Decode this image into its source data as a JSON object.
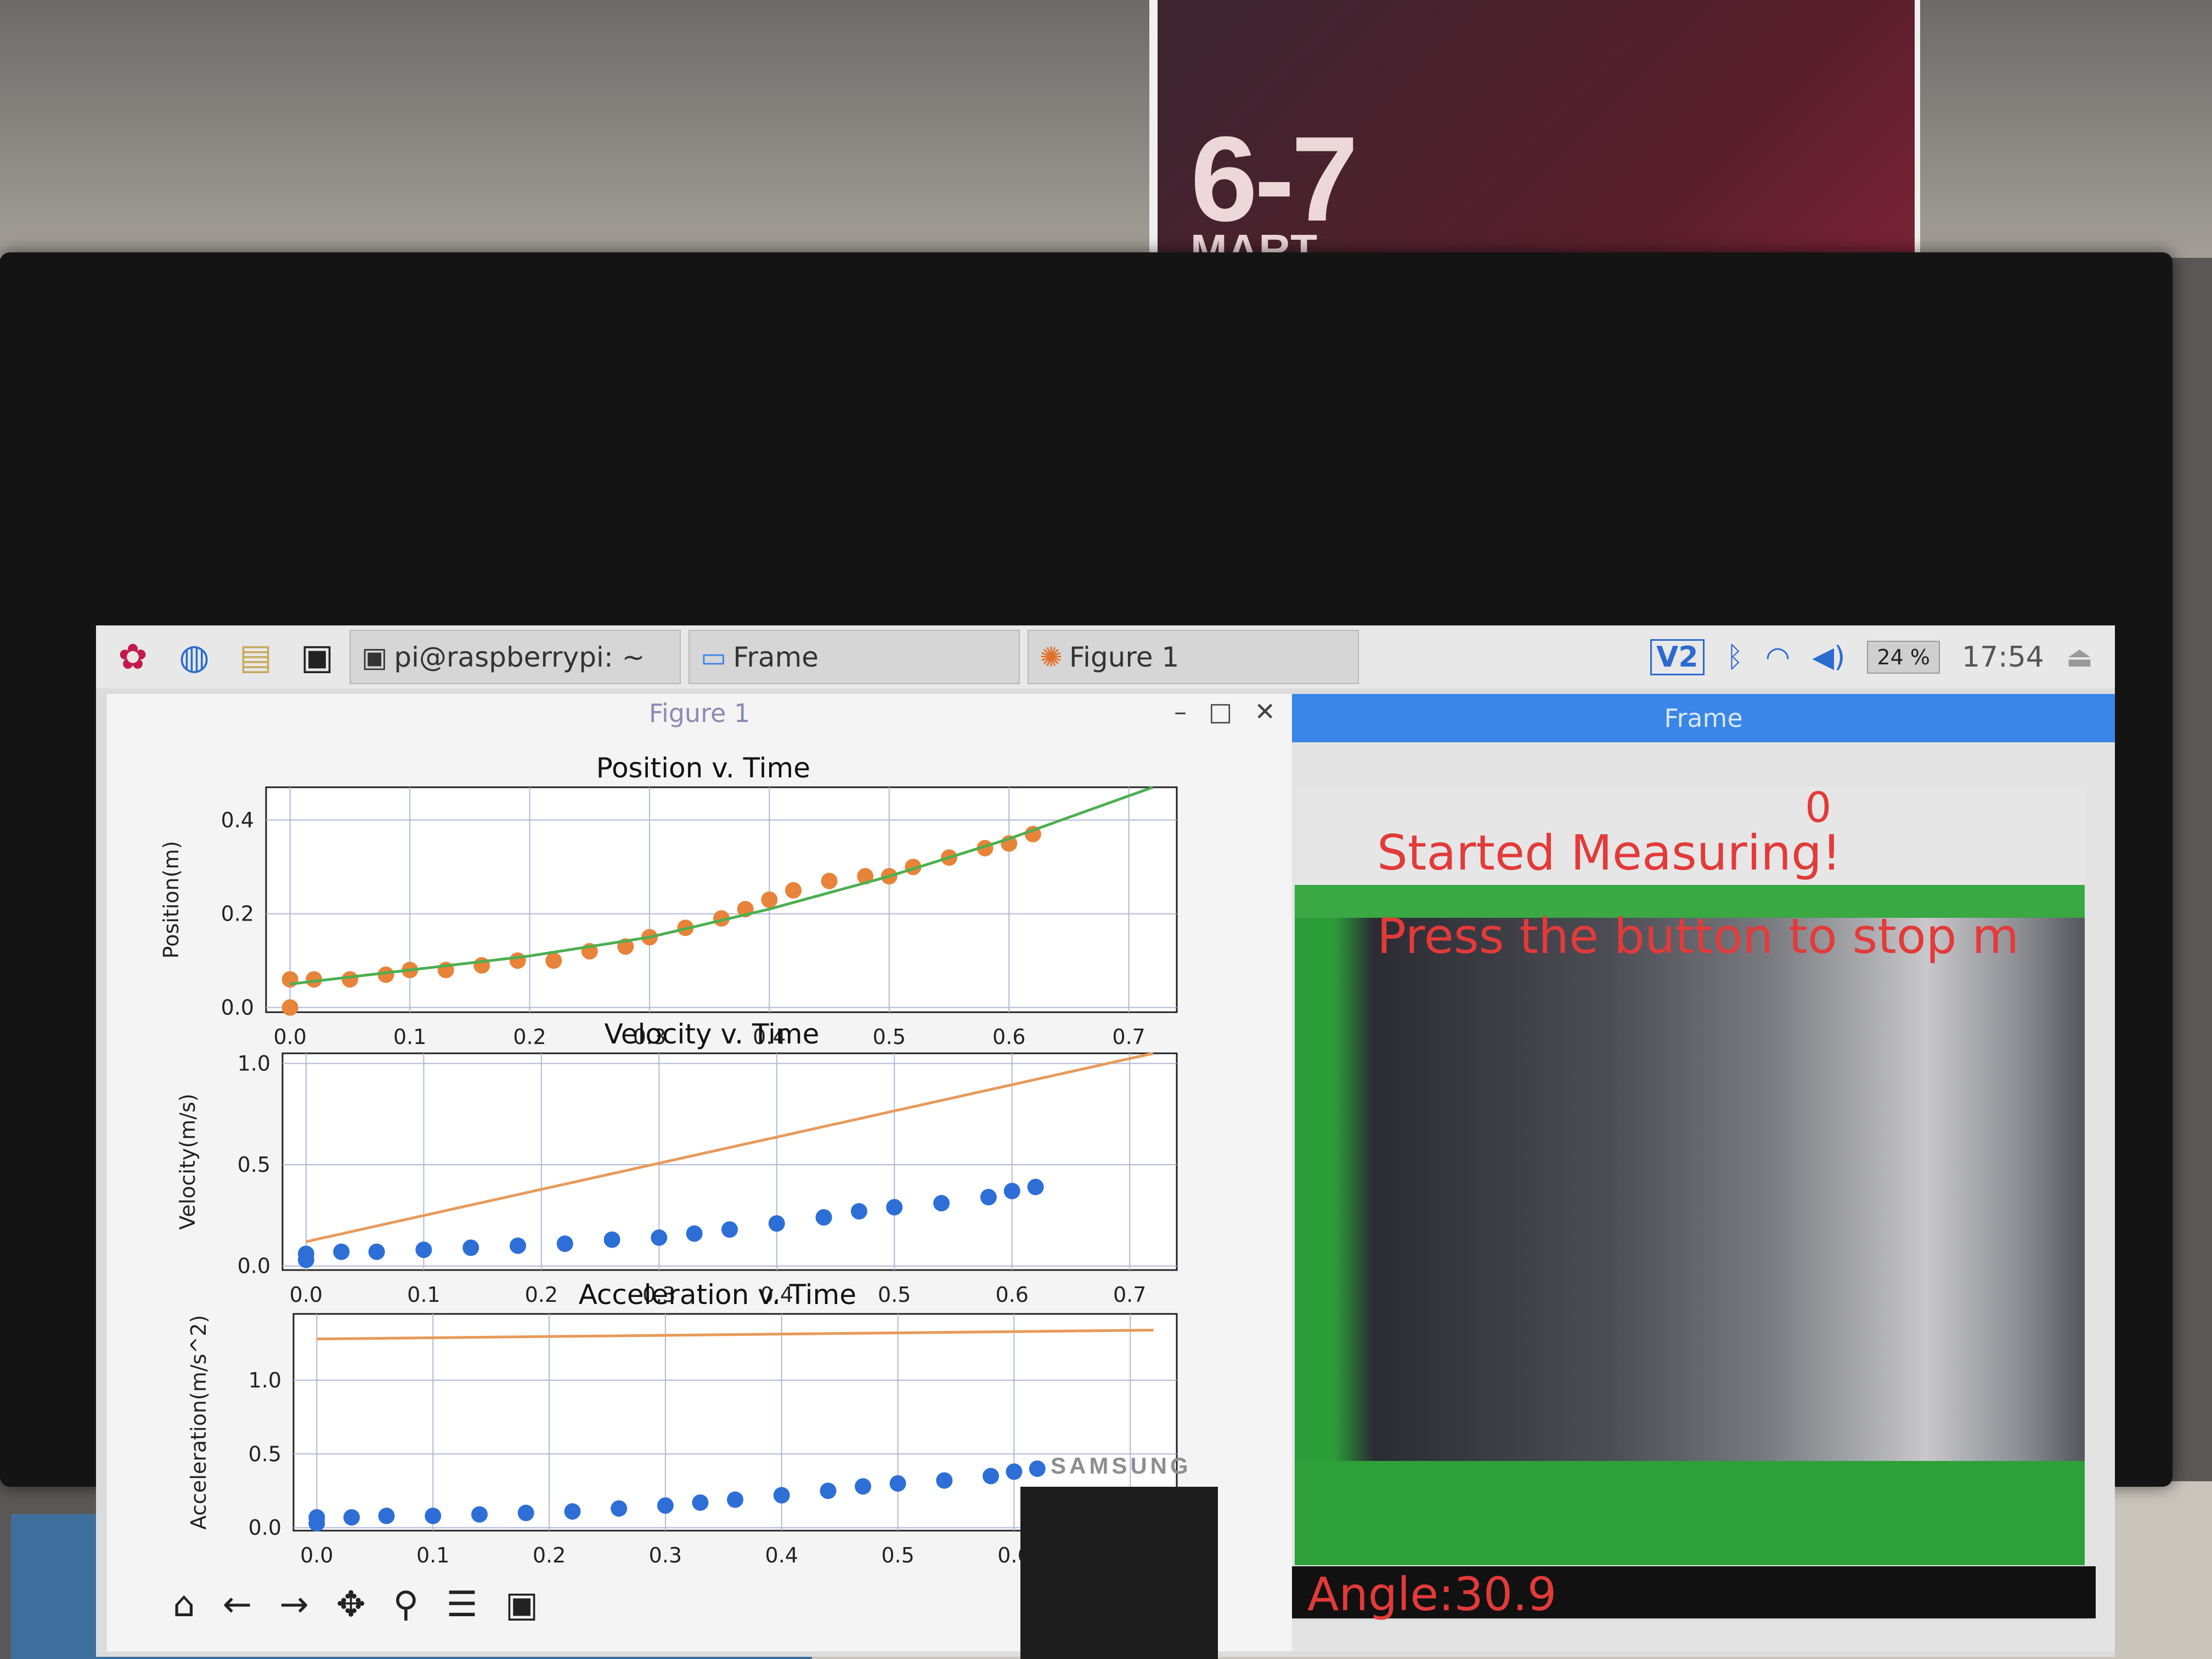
{
  "poster": {
    "date_big": "6-7",
    "date_sub": "MART"
  },
  "monitor": {
    "brand": "SAMSUNG"
  },
  "taskbar": {
    "tasks": [
      {
        "label": "pi@raspberrypi: ~"
      },
      {
        "label": "Frame"
      },
      {
        "label": "Figure 1"
      }
    ],
    "cpu_label": "24 %",
    "clock": "17:54",
    "icons": [
      "raspberry-menu-icon",
      "globe-icon",
      "file-manager-icon",
      "terminal-icon",
      "vnc-icon",
      "bluetooth-icon",
      "wifi-icon",
      "volume-icon",
      "eject-icon"
    ]
  },
  "figure_window": {
    "title": "Figure 1",
    "toolbar_icons": [
      "home-icon",
      "back-icon",
      "forward-icon",
      "pan-icon",
      "zoom-icon",
      "configure-icon",
      "save-icon"
    ]
  },
  "frame_window": {
    "title": "Frame",
    "counter": "0",
    "line1": "Started Measuring!",
    "line2": "Press the button to stop m",
    "angle": "Angle:30.9"
  },
  "colors": {
    "scatter_orange": "#e8833a",
    "fit_green": "#4caf50",
    "scatter_blue": "#2d6fd6",
    "fit_orange": "#e89a5a",
    "overlay_red": "#e33a3a",
    "title_blue": "#3a85e8"
  },
  "chart_data": [
    {
      "type": "scatter",
      "title": "Position v. Time",
      "ylabel": "Position(m)",
      "xlabel": "",
      "xlim": [
        -0.02,
        0.74
      ],
      "ylim": [
        -0.01,
        0.47
      ],
      "xticks": [
        "0.0",
        "0.1",
        "0.2",
        "0.3",
        "0.4",
        "0.5",
        "0.6",
        "0.7"
      ],
      "yticks": [
        "0.0",
        "0.2",
        "0.4"
      ],
      "grid": true,
      "series": [
        {
          "kind": "scatter",
          "x": [
            0.0,
            0.0,
            0.02,
            0.05,
            0.08,
            0.1,
            0.13,
            0.16,
            0.19,
            0.22,
            0.25,
            0.28,
            0.3,
            0.33,
            0.36,
            0.38,
            0.4,
            0.42,
            0.45,
            0.48,
            0.5,
            0.52,
            0.55,
            0.58,
            0.6,
            0.62
          ],
          "y": [
            0.0,
            0.06,
            0.06,
            0.06,
            0.07,
            0.08,
            0.08,
            0.09,
            0.1,
            0.1,
            0.12,
            0.13,
            0.15,
            0.17,
            0.19,
            0.21,
            0.23,
            0.25,
            0.27,
            0.28,
            0.28,
            0.3,
            0.32,
            0.34,
            0.35,
            0.37
          ]
        },
        {
          "kind": "line",
          "x": [
            0.0,
            0.1,
            0.2,
            0.3,
            0.4,
            0.5,
            0.6,
            0.72
          ],
          "y": [
            0.05,
            0.08,
            0.11,
            0.15,
            0.21,
            0.28,
            0.36,
            0.47
          ]
        }
      ]
    },
    {
      "type": "scatter",
      "title": "Velocity v. Time",
      "ylabel": "Velocity(m/s)",
      "xlabel": "",
      "xlim": [
        -0.02,
        0.74
      ],
      "ylim": [
        -0.02,
        1.05
      ],
      "xticks": [
        "0.0",
        "0.1",
        "0.2",
        "0.3",
        "0.4",
        "0.5",
        "0.6",
        "0.7"
      ],
      "yticks": [
        "0.0",
        "0.5",
        "1.0"
      ],
      "grid": true,
      "series": [
        {
          "kind": "scatter",
          "x": [
            0.0,
            0.0,
            0.03,
            0.06,
            0.1,
            0.14,
            0.18,
            0.22,
            0.26,
            0.3,
            0.33,
            0.36,
            0.4,
            0.44,
            0.47,
            0.5,
            0.54,
            0.58,
            0.6,
            0.62
          ],
          "y": [
            0.03,
            0.06,
            0.07,
            0.07,
            0.08,
            0.09,
            0.1,
            0.11,
            0.13,
            0.14,
            0.16,
            0.18,
            0.21,
            0.24,
            0.27,
            0.29,
            0.31,
            0.34,
            0.37,
            0.39
          ]
        },
        {
          "kind": "line",
          "x": [
            0.0,
            0.72
          ],
          "y": [
            0.12,
            1.05
          ]
        }
      ]
    },
    {
      "type": "scatter",
      "title": "Acceleration v. Time",
      "ylabel": "Acceleration(m/s^2)",
      "xlabel": "",
      "xlim": [
        -0.02,
        0.74
      ],
      "ylim": [
        -0.02,
        1.45
      ],
      "xticks": [
        "0.0",
        "0.1",
        "0.2",
        "0.3",
        "0.4",
        "0.5",
        "0.6",
        "0.7"
      ],
      "yticks": [
        "0.0",
        "0.5",
        "1.0"
      ],
      "grid": true,
      "series": [
        {
          "kind": "scatter",
          "x": [
            0.0,
            0.0,
            0.03,
            0.06,
            0.1,
            0.14,
            0.18,
            0.22,
            0.26,
            0.3,
            0.33,
            0.36,
            0.4,
            0.44,
            0.47,
            0.5,
            0.54,
            0.58,
            0.6,
            0.62
          ],
          "y": [
            0.03,
            0.07,
            0.07,
            0.08,
            0.08,
            0.09,
            0.1,
            0.11,
            0.13,
            0.15,
            0.17,
            0.19,
            0.22,
            0.25,
            0.28,
            0.3,
            0.32,
            0.35,
            0.38,
            0.4
          ]
        },
        {
          "kind": "line",
          "x": [
            0.0,
            0.72
          ],
          "y": [
            1.28,
            1.34
          ]
        }
      ]
    }
  ]
}
